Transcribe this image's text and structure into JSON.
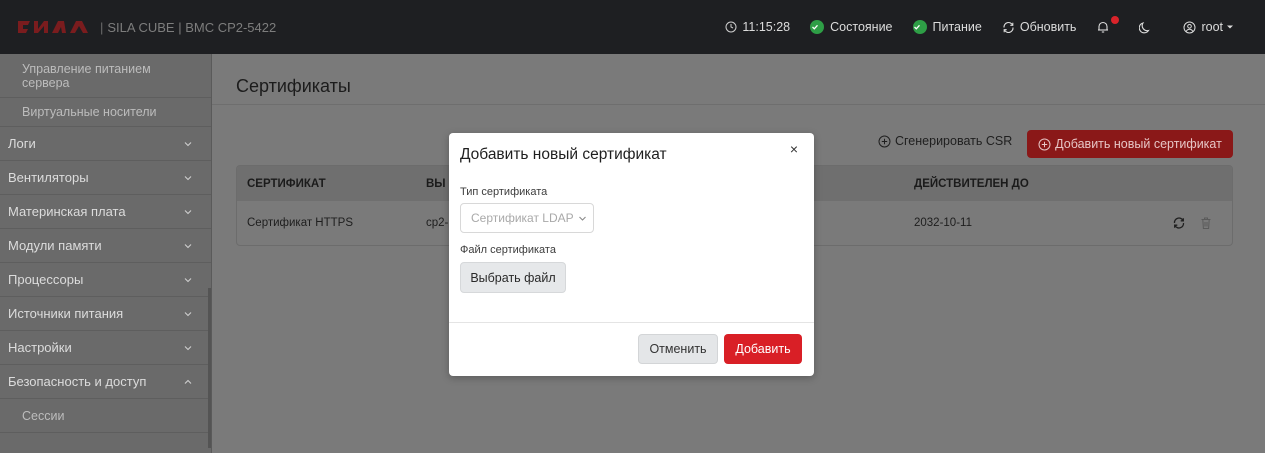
{
  "header": {
    "brand_logo_text": "СИЛА",
    "brand_separator": "|",
    "brand_text": "SILA CUBE | BMC CP2-5422",
    "time": "11:15:28",
    "status_label": "Состояние",
    "power_label": "Питание",
    "refresh_label": "Обновить",
    "user_label": "root",
    "colors": {
      "background": "#1e1f22",
      "ok": "#2e9e46",
      "alert": "#d9232a",
      "logo": "#d9232a"
    }
  },
  "sidebar": {
    "subitems_top": [
      {
        "label": "Управление питанием сервера"
      },
      {
        "label": "Виртуальные носители"
      }
    ],
    "items": [
      {
        "label": "Логи",
        "chevron": "down"
      },
      {
        "label": "Вентиляторы",
        "chevron": "down"
      },
      {
        "label": "Материнская плата",
        "chevron": "down"
      },
      {
        "label": "Модули памяти",
        "chevron": "down"
      },
      {
        "label": "Процессоры",
        "chevron": "down"
      },
      {
        "label": "Источники питания",
        "chevron": "down"
      },
      {
        "label": "Настройки",
        "chevron": "down"
      },
      {
        "label": "Безопасность и доступ",
        "chevron": "up"
      }
    ],
    "subitems_bottom": [
      {
        "label": "Сессии"
      }
    ]
  },
  "main": {
    "title": "Сертификаты",
    "generate_csr_label": "Сгенерировать CSR",
    "add_cert_label": "Добавить новый сертификат",
    "table": {
      "headers": [
        "СЕРТИФИКАТ",
        "ВЫ",
        "ДЕЙСТВИТЕЛЕН ДО"
      ],
      "rows": [
        {
          "cert": "Сертификат HTTPS",
          "issued": "cp2-",
          "valid_until": "2032-10-11"
        }
      ]
    }
  },
  "modal": {
    "title": "Добавить новый сертификат",
    "close_symbol": "×",
    "type_label": "Тип сертификата",
    "type_value": "Сертификат LDAP",
    "file_label": "Файл сертификата",
    "choose_file_label": "Выбрать файл",
    "cancel_label": "Отменить",
    "submit_label": "Добавить",
    "colors": {
      "primary": "#d91f26"
    }
  }
}
